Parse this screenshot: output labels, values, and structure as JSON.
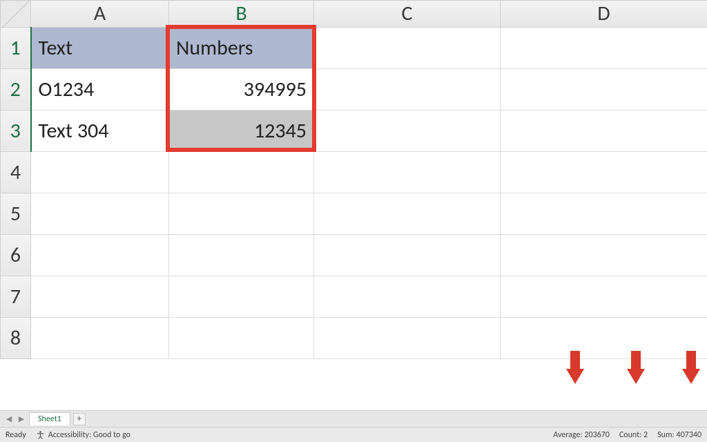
{
  "columns": {
    "A": "A",
    "B": "B",
    "C": "C",
    "D": "D"
  },
  "rows": [
    "1",
    "2",
    "3",
    "4",
    "5",
    "6",
    "7",
    "8"
  ],
  "cells": {
    "A1": "Text",
    "B1": "Numbers",
    "A2": "O1234",
    "B2": "394995",
    "A3": "Text 304",
    "B3": "12345"
  },
  "tabs": {
    "active": "Sheet1"
  },
  "status": {
    "ready": "Ready",
    "accessibility": "Accessibility: Good to go",
    "average_label": "Average:",
    "average_value": "203670",
    "count_label": "Count:",
    "count_value": "2",
    "sum_label": "Sum:",
    "sum_value": "407340"
  },
  "highlight": {
    "col": "B",
    "rows": [
      1,
      3
    ]
  },
  "annotation": "red-down-arrows point to status bar aggregate values"
}
